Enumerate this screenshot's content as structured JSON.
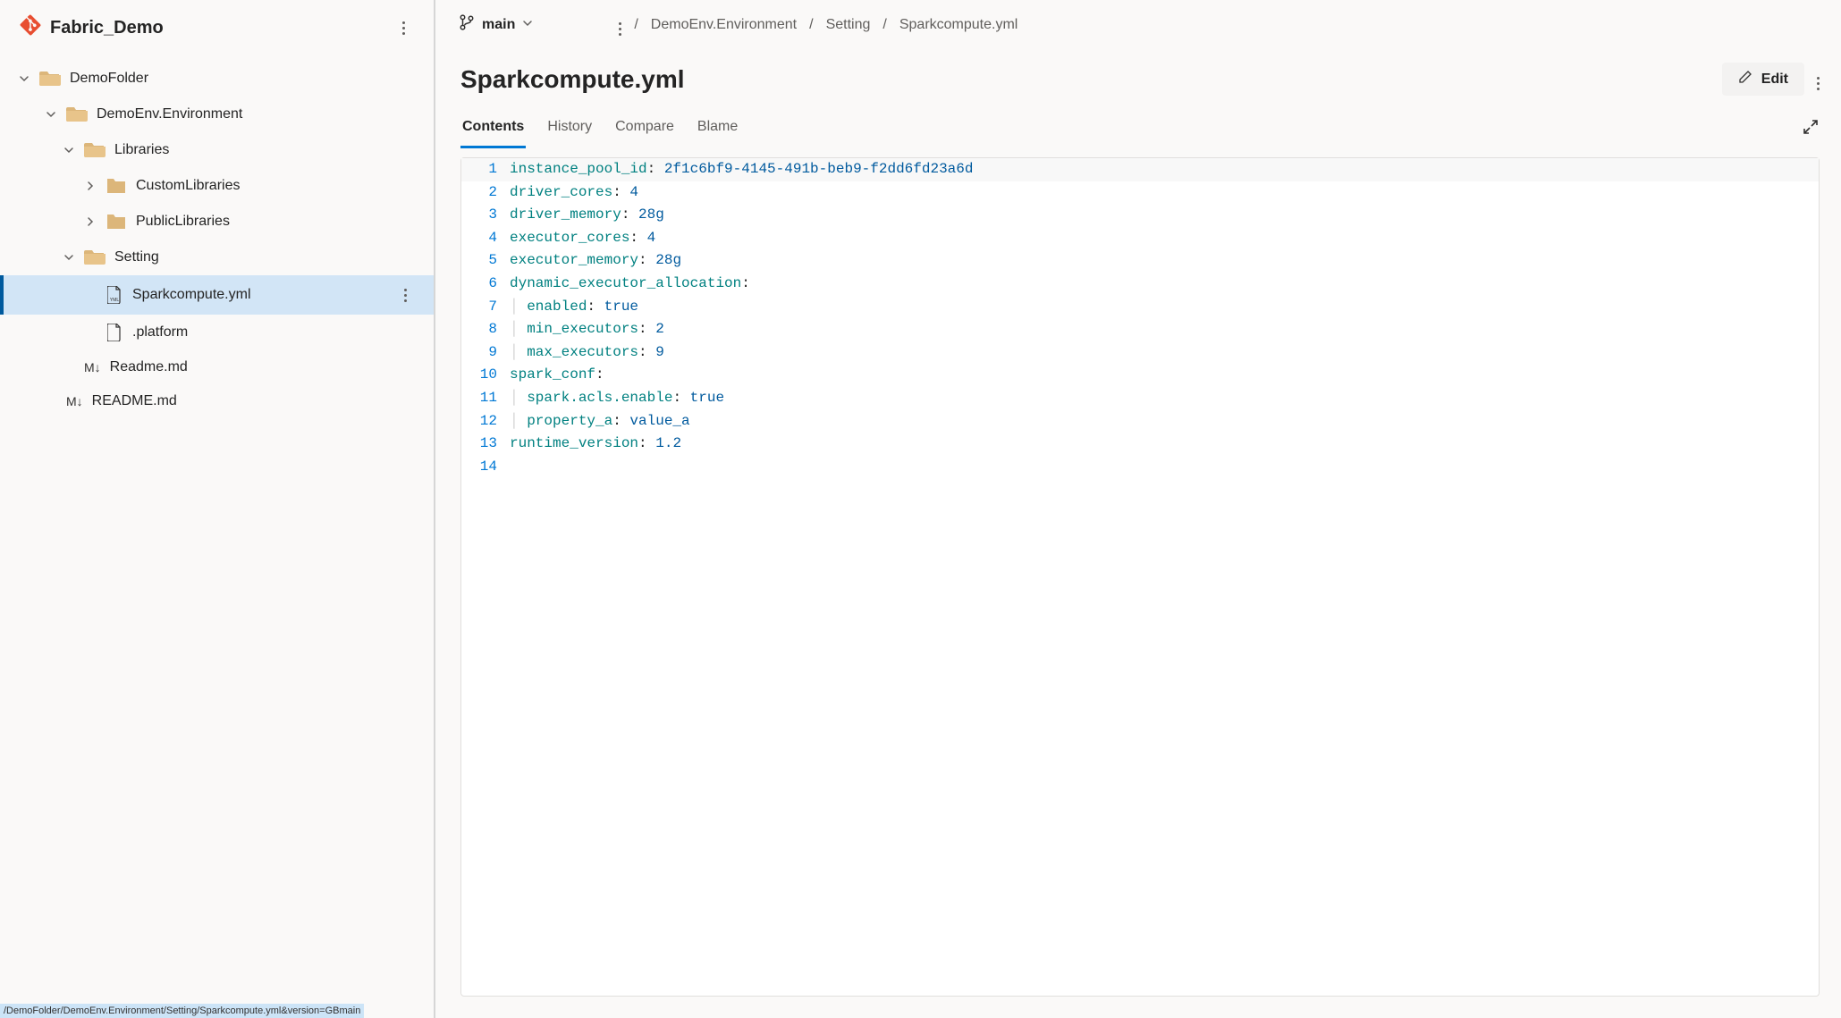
{
  "repo": {
    "name": "Fabric_Demo"
  },
  "tree": {
    "root_folder": "DemoFolder",
    "env_folder": "DemoEnv.Environment",
    "libraries_folder": "Libraries",
    "custom_libs": "CustomLibraries",
    "public_libs": "PublicLibraries",
    "setting_folder": "Setting",
    "sparkcompute_file": "Sparkcompute.yml",
    "platform_file": ".platform",
    "readme1": "Readme.md",
    "readme2": "README.md"
  },
  "status_path": "/DemoFolder/DemoEnv.Environment/Setting/Sparkcompute.yml&version=GBmain",
  "branch": {
    "name": "main"
  },
  "breadcrumbs": {
    "sep": "/",
    "p1": "DemoEnv.Environment",
    "p2": "Setting",
    "p3": "Sparkcompute.yml"
  },
  "file": {
    "title": "Sparkcompute.yml",
    "edit_label": "Edit"
  },
  "tabs": {
    "contents": "Contents",
    "history": "History",
    "compare": "Compare",
    "blame": "Blame"
  },
  "code": {
    "l1": {
      "key": "instance_pool_id",
      "val": "2f1c6bf9-4145-491b-beb9-f2dd6fd23a6d"
    },
    "l2": {
      "key": "driver_cores",
      "val": "4"
    },
    "l3": {
      "key": "driver_memory",
      "val": "28g"
    },
    "l4": {
      "key": "executor_cores",
      "val": "4"
    },
    "l5": {
      "key": "executor_memory",
      "val": "28g"
    },
    "l6": {
      "key": "dynamic_executor_allocation"
    },
    "l7": {
      "key": "enabled",
      "val": "true"
    },
    "l8": {
      "key": "min_executors",
      "val": "2"
    },
    "l9": {
      "key": "max_executors",
      "val": "9"
    },
    "l10": {
      "key": "spark_conf"
    },
    "l11": {
      "key": "spark.acls.enable",
      "val": "true"
    },
    "l12": {
      "key": "property_a",
      "val": "value_a"
    },
    "l13": {
      "key": "runtime_version",
      "val": "1.2"
    }
  },
  "line_numbers": {
    "n1": "1",
    "n2": "2",
    "n3": "3",
    "n4": "4",
    "n5": "5",
    "n6": "6",
    "n7": "7",
    "n8": "8",
    "n9": "9",
    "n10": "10",
    "n11": "11",
    "n12": "12",
    "n13": "13",
    "n14": "14"
  }
}
